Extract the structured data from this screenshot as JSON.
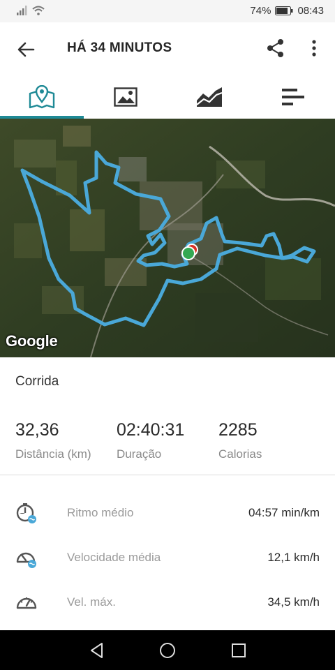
{
  "status_bar": {
    "battery": "74%",
    "time": "08:43"
  },
  "header": {
    "title": "HÁ 34 MINUTOS"
  },
  "tabs": [
    {
      "name": "map",
      "icon": "map-pin-icon"
    },
    {
      "name": "photos",
      "icon": "image-icon"
    },
    {
      "name": "charts",
      "icon": "chart-icon"
    },
    {
      "name": "splits",
      "icon": "bars-icon"
    }
  ],
  "map": {
    "attribution": "Google"
  },
  "activity": {
    "type": "Corrida"
  },
  "summary": {
    "distance_value": "32,36",
    "distance_label": "Distância (km)",
    "duration_value": "02:40:31",
    "duration_label": "Duração",
    "calories_value": "2285",
    "calories_label": "Calorias"
  },
  "details": [
    {
      "label": "Ritmo médio",
      "value": "04:57 min/km",
      "icon": "pace-icon"
    },
    {
      "label": "Velocidade média",
      "value": "12,1 km/h",
      "icon": "speed-icon"
    },
    {
      "label": "Vel. máx.",
      "value": "34,5 km/h",
      "icon": "speedometer-icon"
    }
  ],
  "colors": {
    "accent": "#1f8a96",
    "route": "#4aa8d8",
    "start_marker": "#34a853",
    "end_marker": "#d93025"
  }
}
